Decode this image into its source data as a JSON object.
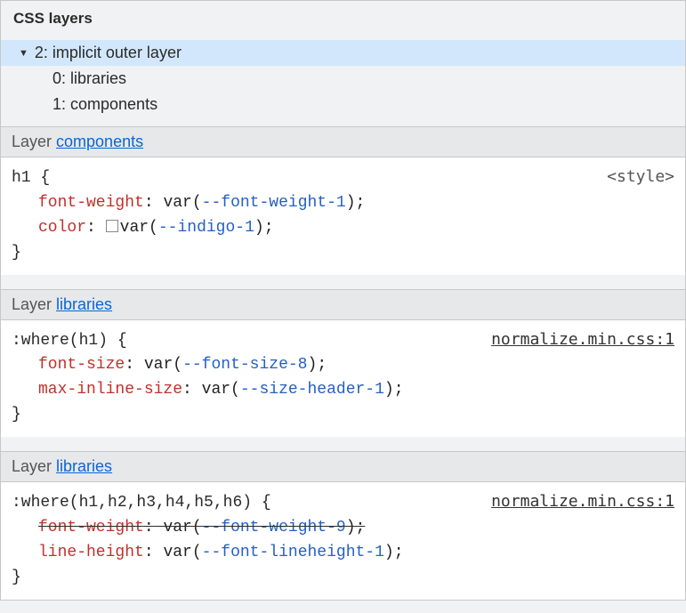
{
  "panel": {
    "title": "CSS layers"
  },
  "tree": {
    "root": {
      "label": "2: implicit outer layer"
    },
    "children": [
      {
        "label": "0: libraries"
      },
      {
        "label": "1: components"
      }
    ]
  },
  "sections": [
    {
      "header_prefix": "Layer ",
      "header_link": "components",
      "source": "<style>",
      "source_is_link": false,
      "selector": "h1",
      "declarations": [
        {
          "prop": "font-weight",
          "var": "--font-weight-1",
          "swatch": false,
          "struck": false
        },
        {
          "prop": "color",
          "var": "--indigo-1",
          "swatch": true,
          "struck": false
        }
      ]
    },
    {
      "header_prefix": "Layer ",
      "header_link": "libraries",
      "source": "normalize.min.css:1",
      "source_is_link": true,
      "selector": ":where(h1)",
      "declarations": [
        {
          "prop": "font-size",
          "var": "--font-size-8",
          "swatch": false,
          "struck": false
        },
        {
          "prop": "max-inline-size",
          "var": "--size-header-1",
          "swatch": false,
          "struck": false
        }
      ]
    },
    {
      "header_prefix": "Layer ",
      "header_link": "libraries",
      "source": "normalize.min.css:1",
      "source_is_link": true,
      "selector": ":where(h1,h2,h3,h4,h5,h6)",
      "declarations": [
        {
          "prop": "font-weight",
          "var": "--font-weight-9",
          "swatch": false,
          "struck": true
        },
        {
          "prop": "line-height",
          "var": "--font-lineheight-1",
          "swatch": false,
          "struck": false
        }
      ]
    }
  ]
}
